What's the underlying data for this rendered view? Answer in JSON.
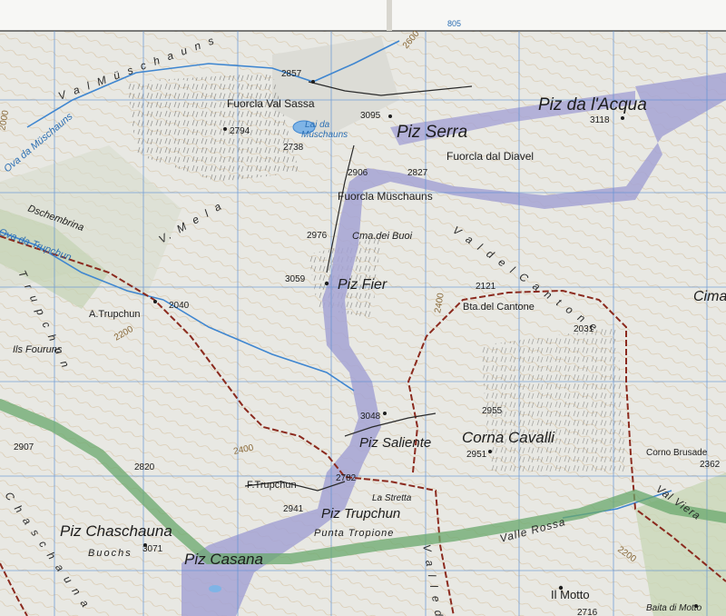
{
  "colors": {
    "paper": "#f4f3ee",
    "terrain": "#e9e9e4",
    "contour": "#c9a97a",
    "grid": "#5b8fd4",
    "water": "#3f86d0",
    "glacier": "#9a98cf",
    "border_red": "#8b2a1e",
    "trail_green": "#6aa86c",
    "rock": "#3c3c3c"
  },
  "grid": {
    "top_label": "805"
  },
  "peaks": {
    "piz_serra": "Piz Serra",
    "piz_da_lacqua": "Piz da l'Acqua",
    "piz_fier": "Piz Fier",
    "piz_saliente": "Piz Saliente",
    "corna_cavalli": "Corna Cavalli",
    "piz_trupchun": "Piz Trupchun",
    "piz_chaschauna": "Piz Chaschauna",
    "piz_casana": "Piz Casana",
    "cima": "Cima"
  },
  "places": {
    "fuorcla_val_sassa": "Fuorcla Val Sassa",
    "lai_da_muschauns_1": "Lai da",
    "lai_da_muschauns_2": "Müschauns",
    "fuorcla_dal_diavel": "Fuorcla dal Diavel",
    "fuorcla_muschauns": "Fuorcla Müschauns",
    "cma_dei_buoi": "Cma.dei Buoi",
    "bta_del_cantone": "Bta.del Cantone",
    "a_trupchun": "A.Trupchun",
    "ils_fouruns": "Ils Fouruns",
    "dschembrina": "Dschembrina",
    "f_trupchun": "F.Trupchun",
    "la_stretta": "La Stretta",
    "punta_tropione": "Punta Tropione",
    "buochs": "Buochs",
    "corno_brusade": "Corno Brusade",
    "il_motto": "Il Motto",
    "baita_di_motto": "Baita di Motto",
    "ova_da_muschauns": "Ova da Müschauns",
    "ova_da_trupchun": "Ova da Trupchun"
  },
  "valleys": {
    "val_muschauns": "V a l   M ü s c h a u n s",
    "v_mela": "V. M e l a",
    "val_del_cantone": "V a l   d e l   C a n t o n e",
    "val_trupchun": "T r u p c h u n",
    "val_chaschauna": "C h a s c h a u n a",
    "valle_rossa": "Valle Rossa",
    "val_viera": "Val Viera",
    "valle_d": "V a l l e   d"
  },
  "elevations": {
    "e2857": "2857",
    "e3095": "3095",
    "e2794": "2794",
    "e2738": "2738",
    "e3118": "3118",
    "e2906": "2906",
    "e2827": "2827",
    "e2976": "2976",
    "e3059": "3059",
    "e2121": "2121",
    "e2031": "2031",
    "e2040": "2040",
    "e3048": "3048",
    "e2955": "2955",
    "e2951": "2951",
    "e2907": "2907",
    "e2820": "2820",
    "e2782": "2782",
    "e2941": "2941",
    "e3071": "3071",
    "e2362": "2362",
    "e2716": "2716"
  },
  "contours": {
    "c2600": "2600",
    "c2400a": "2400",
    "c2400b": "2400",
    "c2200a": "2200",
    "c2200b": "2200",
    "c2000": "2000"
  }
}
